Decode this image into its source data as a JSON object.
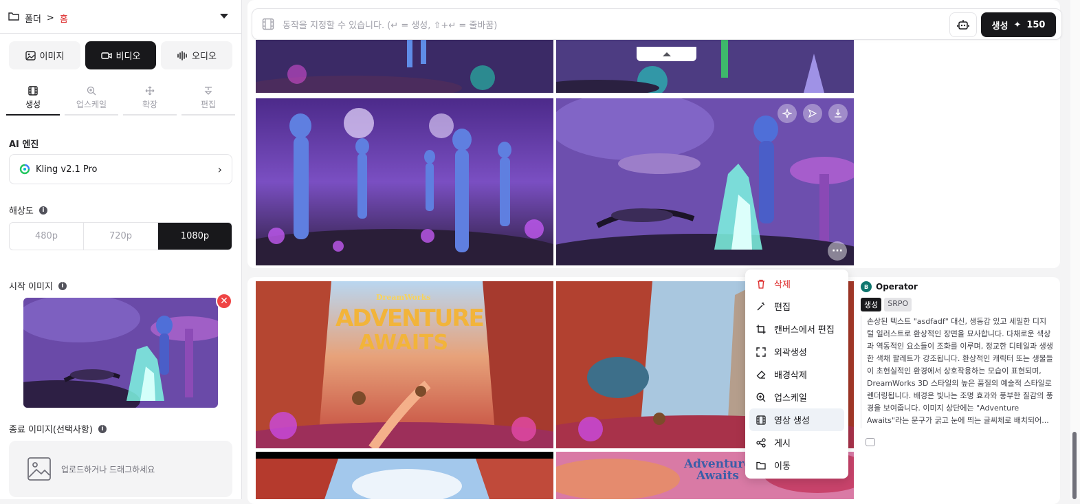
{
  "sidebar": {
    "breadcrumb": {
      "folder": "폴더",
      "sep": ">",
      "home": "홈"
    },
    "media_tabs": [
      {
        "label": "이미지",
        "icon": "image-icon"
      },
      {
        "label": "비디오",
        "icon": "video-icon",
        "active": true
      },
      {
        "label": "오디오",
        "icon": "audio-wave-icon"
      }
    ],
    "sub_tabs": [
      {
        "label": "생성",
        "active": true
      },
      {
        "label": "업스케일"
      },
      {
        "label": "확장"
      },
      {
        "label": "편집"
      }
    ],
    "engine_label": "AI 엔진",
    "engine_value": "Kling v2.1 Pro",
    "resolution_label": "해상도",
    "resolutions": [
      "480p",
      "720p",
      "1080p"
    ],
    "resolution_selected": "1080p",
    "start_image_label": "시작 이미지",
    "end_image_label": "종료 이미지(선택사항)",
    "upload_text": "업로드하거나 드래그하세요"
  },
  "prompt": {
    "placeholder": "동작을 지정할 수 있습니다. (↵ = 생성, ⇧+↵ = 줄바꿈)"
  },
  "generate": {
    "label": "생성",
    "credits": "150"
  },
  "image_text": {
    "brand": "DreamWorks",
    "title1": "ADVENTURE",
    "title2": "AWAITS",
    "title_small": "Adventure Awaits"
  },
  "context_menu": [
    {
      "label": "삭제",
      "icon": "trash-icon",
      "danger": true
    },
    {
      "label": "편집",
      "icon": "magic-wand-icon"
    },
    {
      "label": "캔버스에서 편집",
      "icon": "crop-icon"
    },
    {
      "label": "외곽생성",
      "icon": "expand-icon"
    },
    {
      "label": "배경삭제",
      "icon": "eraser-icon"
    },
    {
      "label": "업스케일",
      "icon": "zoom-in-icon"
    },
    {
      "label": "영상 생성",
      "icon": "film-icon",
      "highlighted": true
    },
    {
      "label": "게시",
      "icon": "share-icon"
    },
    {
      "label": "이동",
      "icon": "folder-icon"
    }
  ],
  "generation": {
    "author_initial": "B",
    "author": "Operator",
    "tags": [
      "생성",
      "SRPO"
    ],
    "description": "손상된 텍스트 \"asdfadf\" 대신, 생동감 있고 세밀한 디지털 일러스트로 환상적인 장면을 묘사합니다. 다채로운 색상과 역동적인 요소들이 조화를 이루며, 정교한 디테일과 생생한 색채 팔레트가 강조됩니다. 환상적인 캐릭터 또는 생물들이 초현실적인 환경에서 상호작용하는 모습이 표현되며, DreamWorks 3D 스타일의 높은 품질의 예술적 스타일로 렌더링됩니다. 배경은 빛나는 조명 효과와 풍부한 질감의 풍경을 보여줍니다. 이미지 상단에는 \"Adventure Awaits\"라는 문구가 굵고 눈에 띄는 글씨체로 배치되어..."
  }
}
